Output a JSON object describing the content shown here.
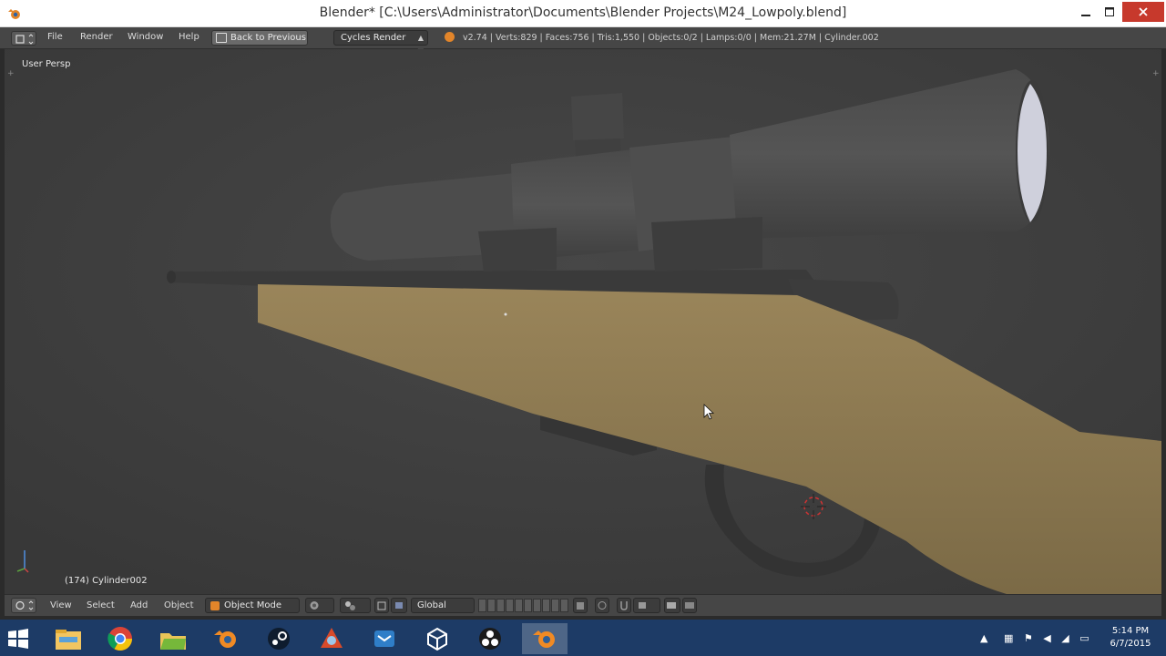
{
  "window": {
    "title": "Blender* [C:\\Users\\Administrator\\Documents\\Blender Projects\\M24_Lowpoly.blend]",
    "minimize_icon": "minimize-icon",
    "maximize_icon": "maximize-icon",
    "close_icon": "close-icon"
  },
  "info_header": {
    "menus": [
      "File",
      "Render",
      "Window",
      "Help"
    ],
    "back_button": "Back to Previous",
    "render_engine": "Cycles Render",
    "stats": "v2.74 | Verts:829 | Faces:756 | Tris:1,550 | Objects:0/2 | Lamps:0/0 | Mem:21.27M | Cylinder.002"
  },
  "viewport": {
    "view_label": "User Persp",
    "object_label": "(174) Cylinder002",
    "colors": {
      "background": "#3e3e3e",
      "scope_metal": "#4f4f4f",
      "stock_wood": "#8d7a51"
    }
  },
  "view3d_header": {
    "menus": [
      "View",
      "Select",
      "Add",
      "Object"
    ],
    "mode": "Object Mode",
    "orientation": "Global"
  },
  "taskbar": {
    "apps": [
      "file-explorer-icon",
      "chrome-icon",
      "folder-icon",
      "blender-icon",
      "steam-icon",
      "app-icon",
      "mail-icon",
      "unity-icon",
      "obs-icon",
      "blender-active-icon"
    ],
    "time": "5:14 PM",
    "date": "6/7/2015"
  }
}
